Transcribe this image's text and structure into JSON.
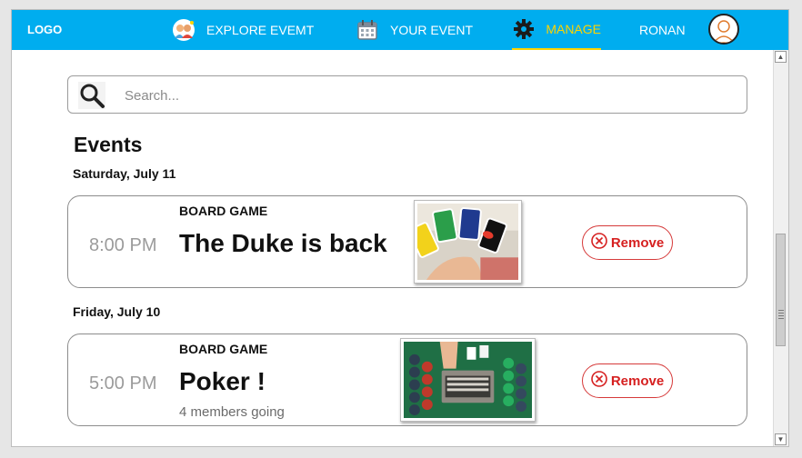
{
  "nav": {
    "logo": "LOGO",
    "explore_label": "EXPLORE EVEMT",
    "your_event_label": "YOUR EVENT",
    "manage_label": "MANAGE",
    "user_name": "RONAN",
    "active_color": "#ffd400",
    "bar_color": "#00adef"
  },
  "search": {
    "placeholder": "Search..."
  },
  "events": {
    "heading": "Events",
    "groups": [
      {
        "date": "Saturday, July 11",
        "time": "8:00 PM",
        "category": "BOARD GAME",
        "title": "The Duke is back",
        "members": "",
        "image": "uno-cards-photo",
        "remove_label": "Remove"
      },
      {
        "date": "Friday, July 10",
        "time": "5:00 PM",
        "category": "BOARD GAME",
        "title": "Poker !",
        "members": "4 members going",
        "image": "poker-table-photo",
        "remove_label": "Remove"
      }
    ]
  },
  "colors": {
    "remove": "#d62020"
  }
}
